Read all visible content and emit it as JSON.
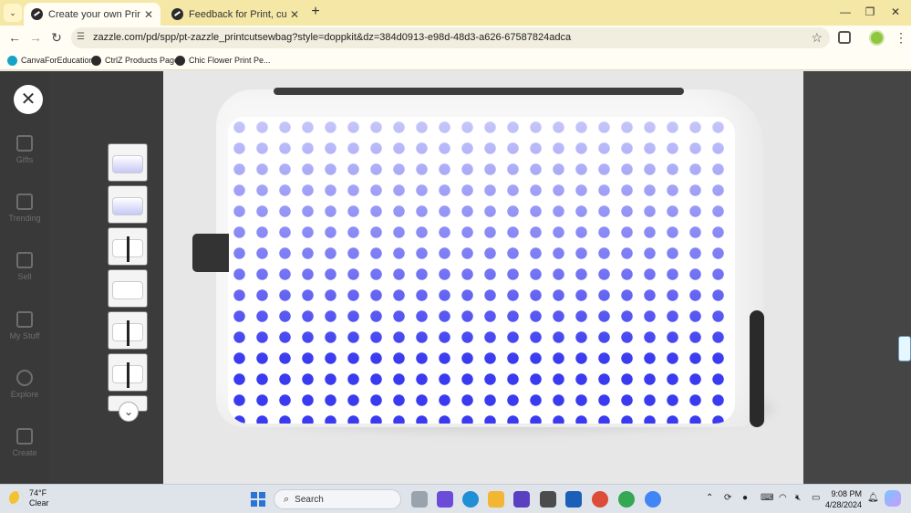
{
  "browser": {
    "tabs": [
      {
        "title": "Create your own Print Cut Sew",
        "active": true
      },
      {
        "title": "Feedback for Print, cut & sew b",
        "active": false
      }
    ],
    "new_tab_label": "+",
    "url": "zazzle.com/pd/spp/pt-zazzle_printcutsewbag?style=doppkit&dz=384d0913-e98d-48d3-a626-67587824adca",
    "bookmarks": [
      {
        "label": "CanvaForEducation",
        "icon": "canva-icon"
      },
      {
        "label": "CtrlZ Products Page",
        "icon": "zazzle-icon"
      },
      {
        "label": "Chic Flower Print Pe...",
        "icon": "zazzle-icon"
      }
    ]
  },
  "sidebar": {
    "items": [
      {
        "label": "Gifts",
        "icon": "gift-icon"
      },
      {
        "label": "Trending",
        "icon": "trending-icon"
      },
      {
        "label": "Sell",
        "icon": "store-icon"
      },
      {
        "label": "My Stuff",
        "icon": "folder-icon"
      },
      {
        "label": "Explore",
        "icon": "lightbulb-icon"
      },
      {
        "label": "Create",
        "icon": "pen-icon"
      }
    ]
  },
  "viewer": {
    "close_glyph": "✕",
    "thumbnail_count": 7,
    "dot_color": "#3a3af0"
  },
  "taskbar": {
    "weather_temp": "74°F",
    "weather_desc": "Clear",
    "search_label": "Search",
    "time": "9:08 PM",
    "date": "4/28/2024"
  }
}
